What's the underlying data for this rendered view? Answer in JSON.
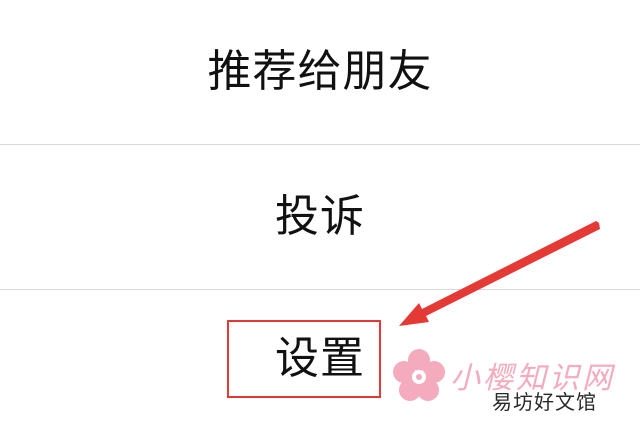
{
  "menu": {
    "items": [
      {
        "label": "推荐给朋友"
      },
      {
        "label": "投诉"
      },
      {
        "label": "设置"
      }
    ]
  },
  "annotation": {
    "highlight_color": "#e53935",
    "arrow_color": "#e53935"
  },
  "watermark": {
    "title": "小樱知识网",
    "subtitle": "易坊好文馆",
    "icon": "cherry-blossom-icon",
    "color": "#f2a3b6"
  }
}
